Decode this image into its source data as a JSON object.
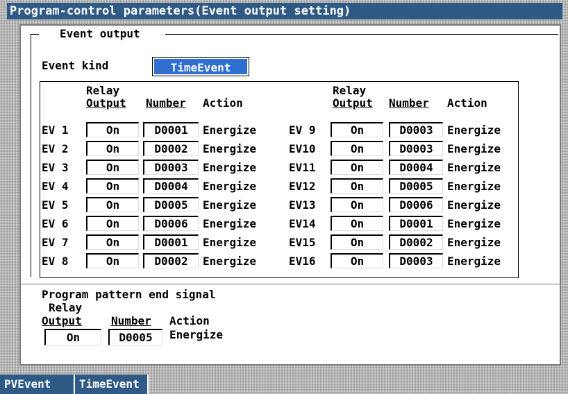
{
  "title": "Program-control parameters(Event output setting)",
  "group_title": "Event output",
  "event_kind_label": "Event kind",
  "event_kind_value": "TimeEvent",
  "columns": {
    "relay_line1": "Relay",
    "relay_line2": "Output",
    "number": "Number",
    "action": "Action"
  },
  "events_left": [
    {
      "label": "EV 1",
      "relay": "On",
      "number": "D0001",
      "action": "Energize"
    },
    {
      "label": "EV 2",
      "relay": "On",
      "number": "D0002",
      "action": "Energize"
    },
    {
      "label": "EV 3",
      "relay": "On",
      "number": "D0003",
      "action": "Energize"
    },
    {
      "label": "EV 4",
      "relay": "On",
      "number": "D0004",
      "action": "Energize"
    },
    {
      "label": "EV 5",
      "relay": "On",
      "number": "D0005",
      "action": "Energize"
    },
    {
      "label": "EV 6",
      "relay": "On",
      "number": "D0006",
      "action": "Energize"
    },
    {
      "label": "EV 7",
      "relay": "On",
      "number": "D0001",
      "action": "Energize"
    },
    {
      "label": "EV 8",
      "relay": "On",
      "number": "D0002",
      "action": "Energize"
    }
  ],
  "events_right": [
    {
      "label": "EV 9",
      "relay": "On",
      "number": "D0003",
      "action": "Energize"
    },
    {
      "label": "EV10",
      "relay": "On",
      "number": "D0003",
      "action": "Energize"
    },
    {
      "label": "EV11",
      "relay": "On",
      "number": "D0004",
      "action": "Energize"
    },
    {
      "label": "EV12",
      "relay": "On",
      "number": "D0005",
      "action": "Energize"
    },
    {
      "label": "EV13",
      "relay": "On",
      "number": "D0006",
      "action": "Energize"
    },
    {
      "label": "EV14",
      "relay": "On",
      "number": "D0001",
      "action": "Energize"
    },
    {
      "label": "EV15",
      "relay": "On",
      "number": "D0002",
      "action": "Energize"
    },
    {
      "label": "EV16",
      "relay": "On",
      "number": "D0003",
      "action": "Energize"
    }
  ],
  "pattern_end": {
    "title": "Program pattern end signal",
    "relay": "On",
    "number": "D0005",
    "action": "Energize"
  },
  "softkeys": [
    "PVEvent",
    "TimeEvent"
  ]
}
